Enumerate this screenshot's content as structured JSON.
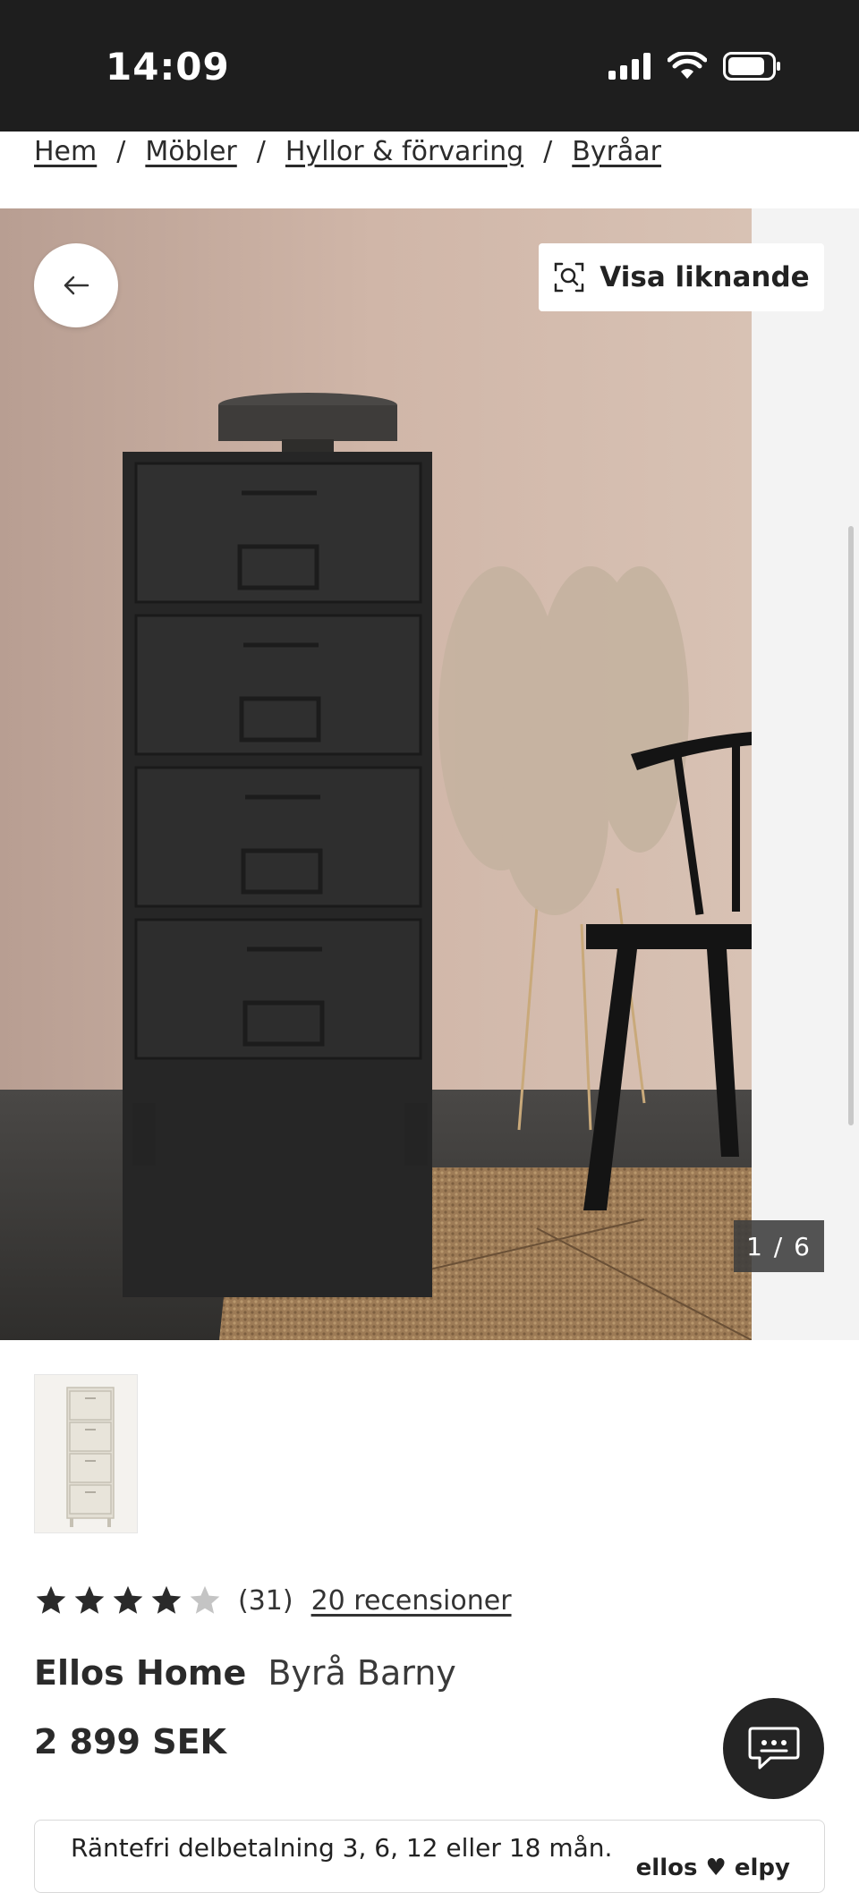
{
  "status_bar": {
    "time": "14:09",
    "icons": [
      "signal-icon",
      "wifi-icon",
      "battery-icon"
    ]
  },
  "breadcrumb": [
    {
      "label": "Hem"
    },
    {
      "label": "Möbler"
    },
    {
      "label": "Hyllor & förvaring"
    },
    {
      "label": "Byråar"
    }
  ],
  "breadcrumb_separator": "/",
  "gallery": {
    "similar_button_label": "Visa liknande",
    "counter": "1 / 6",
    "back_icon": "arrow-left-icon",
    "similar_icon": "visual-search-icon"
  },
  "product": {
    "rating": 4,
    "rating_max": 5,
    "rating_count": "(31)",
    "reviews_link": "20 recensioner",
    "brand": "Ellos Home",
    "name": "Byrå Barny",
    "price": "2 899 SEK"
  },
  "installment": {
    "text": "Räntefri delbetalning 3, 6, 12 eller 18 mån.",
    "logo_text": "ellos ♥ elpy"
  },
  "chat": {
    "icon": "chat-icon"
  },
  "colors": {
    "status_bar": "#1e1e1e",
    "wall": "#cdb3a5",
    "floor": "#3f3e3c",
    "dresser": "#262626",
    "rug": "#9d7b56",
    "star_filled": "#2a2a2a",
    "star_empty": "#c4c4c4"
  }
}
